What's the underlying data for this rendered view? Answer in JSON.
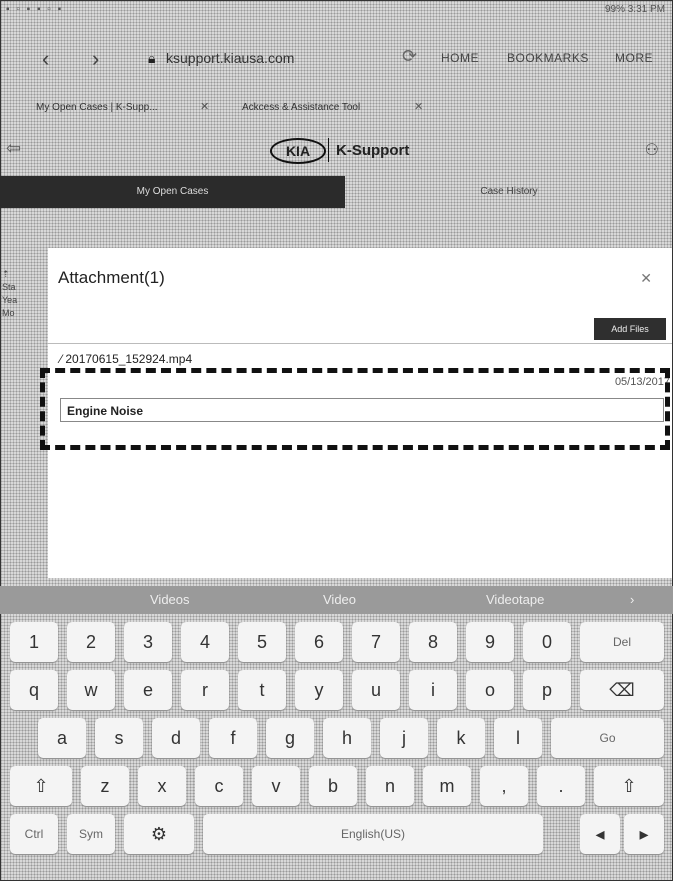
{
  "status_bar": {
    "time": "3:31 PM",
    "battery": "99%"
  },
  "browser": {
    "url": "ksupport.kiausa.com",
    "menu": {
      "home": "HOME",
      "bookmarks": "BOOKMARKS",
      "more": "MORE"
    },
    "tabs": [
      {
        "label": "My Open Cases | K-Supp..."
      },
      {
        "label": "Ackcess & Assistance Tool"
      }
    ]
  },
  "site": {
    "logo": "KIA",
    "title": "K-Support",
    "tabs": {
      "open_cases": "My Open Cases",
      "case_history": "Case History"
    }
  },
  "modal": {
    "title": "Attachment(1)",
    "add_files": "Add Files",
    "file_name": "20170615_152924.mp4",
    "date": "05/13/2017",
    "description": "Engine Noise"
  },
  "keyboard": {
    "suggestions": [
      "Videos",
      "Video",
      "Videotape"
    ],
    "row1": [
      "1",
      "2",
      "3",
      "4",
      "5",
      "6",
      "7",
      "8",
      "9",
      "0"
    ],
    "row2": [
      "q",
      "w",
      "e",
      "r",
      "t",
      "y",
      "u",
      "i",
      "o",
      "p"
    ],
    "row3": [
      "a",
      "s",
      "d",
      "f",
      "g",
      "h",
      "j",
      "k",
      "l"
    ],
    "row4": [
      "z",
      "x",
      "c",
      "v",
      "b",
      "n",
      "m",
      ",",
      "."
    ],
    "del": "Del",
    "go": "Go",
    "ctrl": "Ctrl",
    "sym": "Sym",
    "space": "English(US)"
  }
}
